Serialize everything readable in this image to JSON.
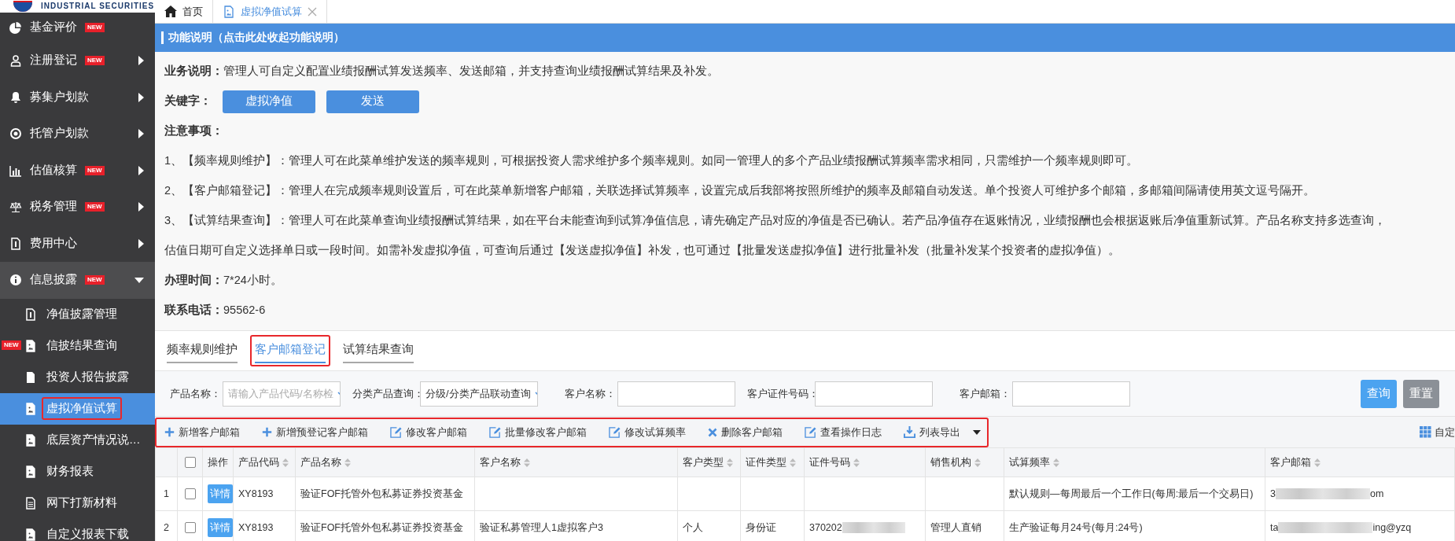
{
  "logo": {
    "text": "INDUSTRIAL SECURITIES"
  },
  "sidebar": {
    "items": [
      {
        "label": "基金评价",
        "badge": "NEW"
      },
      {
        "label": "注册登记",
        "badge": "NEW",
        "expanded": false
      },
      {
        "label": "募集户划款",
        "expanded": false
      },
      {
        "label": "托管户划款",
        "expanded": false
      },
      {
        "label": "估值核算",
        "badge": "NEW",
        "expanded": false
      },
      {
        "label": "税务管理",
        "badge": "NEW",
        "expanded": false
      },
      {
        "label": "费用中心",
        "expanded": false
      },
      {
        "label": "信息披露",
        "badge": "NEW",
        "expanded": true,
        "children": [
          {
            "label": "净值披露管理",
            "selected": false,
            "highlighted": false
          },
          {
            "label": "信披结果查询",
            "badge": "NEW",
            "selected": false,
            "highlighted": false
          },
          {
            "label": "投资人报告披露",
            "selected": false,
            "highlighted": false
          },
          {
            "label": "虚拟净值试算",
            "selected": true,
            "highlighted": true
          },
          {
            "label": "底层资产情况说…",
            "selected": false,
            "highlighted": false
          },
          {
            "label": "财务报表",
            "selected": false,
            "highlighted": false
          },
          {
            "label": "网下打新材料",
            "selected": false,
            "highlighted": false
          },
          {
            "label": "自定义报表下载",
            "selected": false,
            "highlighted": false
          }
        ]
      }
    ]
  },
  "tabs": [
    {
      "label": "首页",
      "selected": false,
      "closable": false
    },
    {
      "label": "虚拟净值试算",
      "selected": true,
      "closable": true
    }
  ],
  "panel": {
    "title": "功能说明（点击此处收起功能说明）",
    "business": {
      "label": "业务说明：",
      "text": "管理人可自定义配置业绩报酬试算发送频率、发送邮箱，并支持查询业绩报酬试算结果及补发。"
    },
    "keywords": {
      "label": "关键字：",
      "buttons": [
        "虚拟净值",
        "发送"
      ]
    },
    "notes_title": "注意事项：",
    "notes": [
      "1、【频率规则维护】：管理人可在此菜单维护发送的频率规则，可根据投资人需求维护多个频率规则。如同一管理人的多个产品业绩报酬试算频率需求相同，只需维护一个频率规则即可。",
      "2、【客户邮箱登记】：管理人在完成频率规则设置后，可在此菜单新增客户邮箱，关联选择试算频率，设置完成后我部将按照所维护的频率及邮箱自动发送。单个投资人可维护多个邮箱，多邮箱间隔请使用英文逗号隔开。",
      "3、【试算结果查询】：管理人可在此菜单查询业绩报酬试算结果，如在平台未能查询到试算净值信息，请先确定产品对应的净值是否已确认。若产品净值存在返账情况，业绩报酬也会根据返账后净值重新试算。产品名称支持多选查询，",
      "估值日期可自定义选择单日或一段时间。如需补发虚拟净值，可查询后通过【发送虚拟净值】补发，也可通过【批量发送虚拟净值】进行批量补发（批量补发某个投资者的虚拟净值）。"
    ],
    "hours": {
      "label": "办理时间：",
      "text": "7*24小时。"
    },
    "phone": {
      "label": "联系电话：",
      "text": "95562-6"
    }
  },
  "subtabs": [
    {
      "label": "频率规则维护",
      "selected": false,
      "highlighted": false
    },
    {
      "label": "客户邮箱登记",
      "selected": true,
      "highlighted": true
    },
    {
      "label": "试算结果查询",
      "selected": false,
      "highlighted": false
    }
  ],
  "filters": [
    {
      "label": "产品名称：",
      "kind": "select",
      "placeholder": "请输入产品代码/名称检"
    },
    {
      "label": "分类产品查询：",
      "kind": "select",
      "value": "分级/分类产品联动查询"
    },
    {
      "label": "客户名称：",
      "kind": "input"
    },
    {
      "label": "客户证件号码：",
      "kind": "input"
    },
    {
      "label": "客户邮箱：",
      "kind": "input"
    }
  ],
  "filter_buttons": [
    {
      "label": "查询",
      "kind": "primary"
    },
    {
      "label": "重置",
      "kind": "secondary"
    }
  ],
  "toolbar": {
    "highlighted": true,
    "actions": [
      {
        "label": "新增客户邮箱"
      },
      {
        "label": "新增预登记客户邮箱"
      },
      {
        "label": "修改客户邮箱"
      },
      {
        "label": "批量修改客户邮箱"
      },
      {
        "label": "修改试算频率"
      },
      {
        "label": "删除客户邮箱"
      },
      {
        "label": "查看操作日志"
      },
      {
        "label": "列表导出",
        "has_menu": true
      }
    ],
    "columns_button": "自定"
  },
  "table": {
    "select_all_checked": false,
    "columns": [
      {
        "label": "操作",
        "sortable": false
      },
      {
        "label": "产品代码",
        "sortable": true
      },
      {
        "label": "产品名称",
        "sortable": true
      },
      {
        "label": "客户名称",
        "sortable": true
      },
      {
        "label": "客户类型",
        "sortable": true
      },
      {
        "label": "证件类型",
        "sortable": true
      },
      {
        "label": "证件号码",
        "sortable": true
      },
      {
        "label": "销售机构",
        "sortable": true
      },
      {
        "label": "试算频率",
        "sortable": true
      },
      {
        "label": "客户邮箱",
        "sortable": true
      }
    ],
    "rows": [
      {
        "index": "1",
        "checked": false,
        "action": "详情",
        "product_code": "XY8193",
        "product_name": "验证FOF托管外包私募证券投资基金",
        "frequency": "默认规则—每周最后一个工作日(每周:最后一个交易日)",
        "email": {
          "start": "3",
          "redacted": true,
          "end": "om"
        }
      },
      {
        "index": "2",
        "checked": false,
        "action": "详情",
        "product_code": "XY8193",
        "product_name": "验证FOF托管外包私募证券投资基金",
        "customer_name": "验证私募管理人1虚拟客户3",
        "customer_type": "个人",
        "id_type": "身份证",
        "id_number": {
          "start": "370202",
          "redacted": true
        },
        "sales_org": "管理人直销",
        "frequency": "生产验证每月24号(每月:24号)",
        "email": {
          "start": "ta",
          "redacted": true,
          "end": "ing@yzq"
        }
      }
    ]
  }
}
